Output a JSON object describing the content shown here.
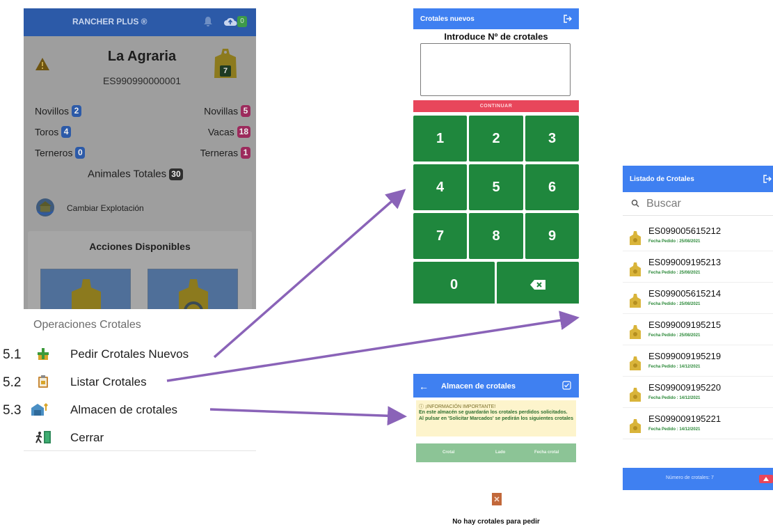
{
  "main_app": {
    "title": "RANCHER PLUS ®",
    "sync_count": "0",
    "farm_name": "La Agraria",
    "farm_code": "ES990990000001",
    "tag_count": "7",
    "stats": [
      {
        "label": "Novillos",
        "value": "2",
        "color": "blue"
      },
      {
        "label": "Novillas",
        "value": "5",
        "color": "pink"
      },
      {
        "label": "Toros",
        "value": "4",
        "color": "blue"
      },
      {
        "label": "Vacas",
        "value": "18",
        "color": "pink"
      },
      {
        "label": "Terneros",
        "value": "0",
        "color": "blue"
      },
      {
        "label": "Terneras",
        "value": "1",
        "color": "pink"
      }
    ],
    "total_label": "Animales Totales",
    "total_value": "30",
    "change_farm_label": "Cambiar Explotación",
    "actions_title": "Acciones Disponibles"
  },
  "menu": {
    "heading": "Operaciones Crotales",
    "items": [
      {
        "number": "5.1",
        "label": "Pedir Crotales Nuevos",
        "icon": "add-tag-icon"
      },
      {
        "number": "5.2",
        "label": "Listar Crotales",
        "icon": "clipboard-icon"
      },
      {
        "number": "5.3",
        "label": "Almacen de crotales",
        "icon": "warehouse-icon"
      },
      {
        "number": "",
        "label": "Cerrar",
        "icon": "exit-door-icon"
      }
    ]
  },
  "new_tags": {
    "title": "Crotales nuevos",
    "prompt": "Introduce Nº de crotales",
    "continue_label": "CONTINUAR",
    "keys": [
      "1",
      "2",
      "3",
      "4",
      "5",
      "6",
      "7",
      "8",
      "9",
      "0"
    ]
  },
  "tag_list": {
    "title": "Listado de Crotales",
    "search_placeholder": "Buscar",
    "items": [
      {
        "code": "ES099005615212",
        "date": "Fecha Pedido : 25/08/2021"
      },
      {
        "code": "ES099009195213",
        "date": "Fecha Pedido : 25/08/2021"
      },
      {
        "code": "ES099005615214",
        "date": "Fecha Pedido : 25/08/2021"
      },
      {
        "code": "ES099009195215",
        "date": "Fecha Pedido : 25/08/2021"
      },
      {
        "code": "ES099009195219",
        "date": "Fecha Pedido : 14/12/2021"
      },
      {
        "code": "ES099009195220",
        "date": "Fecha Pedido : 14/12/2021"
      },
      {
        "code": "ES099009195221",
        "date": "Fecha Pedido : 14/12/2021"
      }
    ],
    "footer": "Número de crotales: 7"
  },
  "store": {
    "title": "Almacen de crotales",
    "notice_title": "ⓘ ¡INFORMACIÓN IMPORTANTE!",
    "notice_body": "En este almacén se guardarán los crotales perdidos solicitados. Al pulsar en 'Solicitar Marcados' se pedirán los siguientes crotales",
    "columns": [
      "Crotal",
      "Lado",
      "Fecha crotal"
    ],
    "empty_text": "No hay crotales para pedir"
  },
  "colors": {
    "accent_blue": "#3f80f1",
    "keypad_green": "#1f873d",
    "continue_red": "#e8465b",
    "arrow_purple": "#8a63b8"
  }
}
